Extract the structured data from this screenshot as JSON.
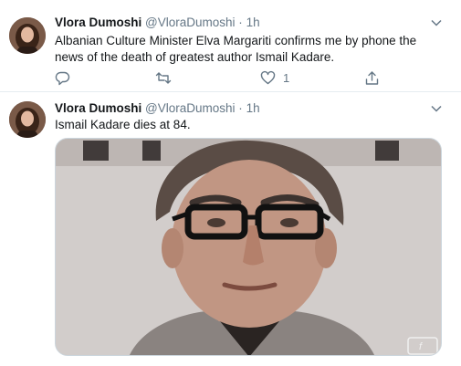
{
  "tweets": [
    {
      "author": "Vlora Dumoshi",
      "handle": "@VloraDumoshi",
      "separator": "·",
      "time": "1h",
      "text": "Albanian Culture Minister Elva Margariti confirms me by phone the news of the death of greatest author Ismail Kadare.",
      "actions": {
        "reply_icon": "reply-icon",
        "retweet_icon": "retweet-icon",
        "like_icon": "heart-icon",
        "like_count": "1",
        "share_icon": "share-icon"
      }
    },
    {
      "author": "Vlora Dumoshi",
      "handle": "@VloraDumoshi",
      "separator": "·",
      "time": "1h",
      "text": "Ismail Kadare dies at 84.",
      "media": {
        "type": "photo",
        "description_icon": "portrait-photo"
      }
    }
  ],
  "colors": {
    "text_primary": "#14171a",
    "text_secondary": "#657786",
    "divider": "#e6ecf0"
  }
}
